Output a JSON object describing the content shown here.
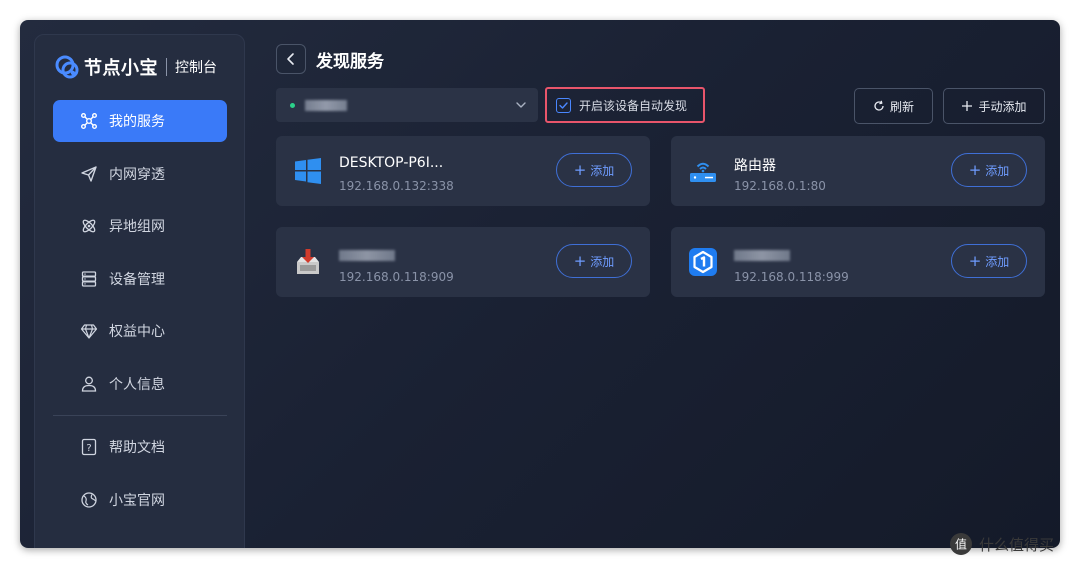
{
  "brand": {
    "name": "节点小宝",
    "sub": "控制台"
  },
  "nav": [
    {
      "label": "我的服务",
      "icon": "network-nodes-icon",
      "active": true
    },
    {
      "label": "内网穿透",
      "icon": "send-icon"
    },
    {
      "label": "异地组网",
      "icon": "atom-icon"
    },
    {
      "label": "设备管理",
      "icon": "server-icon"
    },
    {
      "label": "权益中心",
      "icon": "diamond-icon"
    },
    {
      "label": "个人信息",
      "icon": "user-icon"
    },
    {
      "label": "帮助文档",
      "icon": "help-doc-icon"
    },
    {
      "label": "小宝官网",
      "icon": "website-icon"
    }
  ],
  "page": {
    "title": "发现服务"
  },
  "toolbar": {
    "auto_discover_label": "开启该设备自动发现",
    "auto_discover_checked": true,
    "refresh_label": "刷新",
    "manual_add_label": "手动添加"
  },
  "cards": [
    {
      "name": "DESKTOP-P6I...",
      "address": "192.168.0.132:338",
      "icon": "windows-icon",
      "add_label": "添加"
    },
    {
      "name": "路由器",
      "address": "192.168.0.1:80",
      "icon": "router-icon",
      "add_label": "添加"
    },
    {
      "name": "",
      "address": "192.168.0.118:909",
      "icon": "download-app-icon",
      "add_label": "添加"
    },
    {
      "name": "",
      "address": "192.168.0.118:999",
      "icon": "app-1-icon",
      "add_label": "添加"
    }
  ],
  "watermark": {
    "text": "什么值得买",
    "symbol": "值"
  },
  "colors": {
    "accent": "#3a7af8",
    "highlight_border": "#e8556b",
    "status_online": "#2bd18a"
  }
}
